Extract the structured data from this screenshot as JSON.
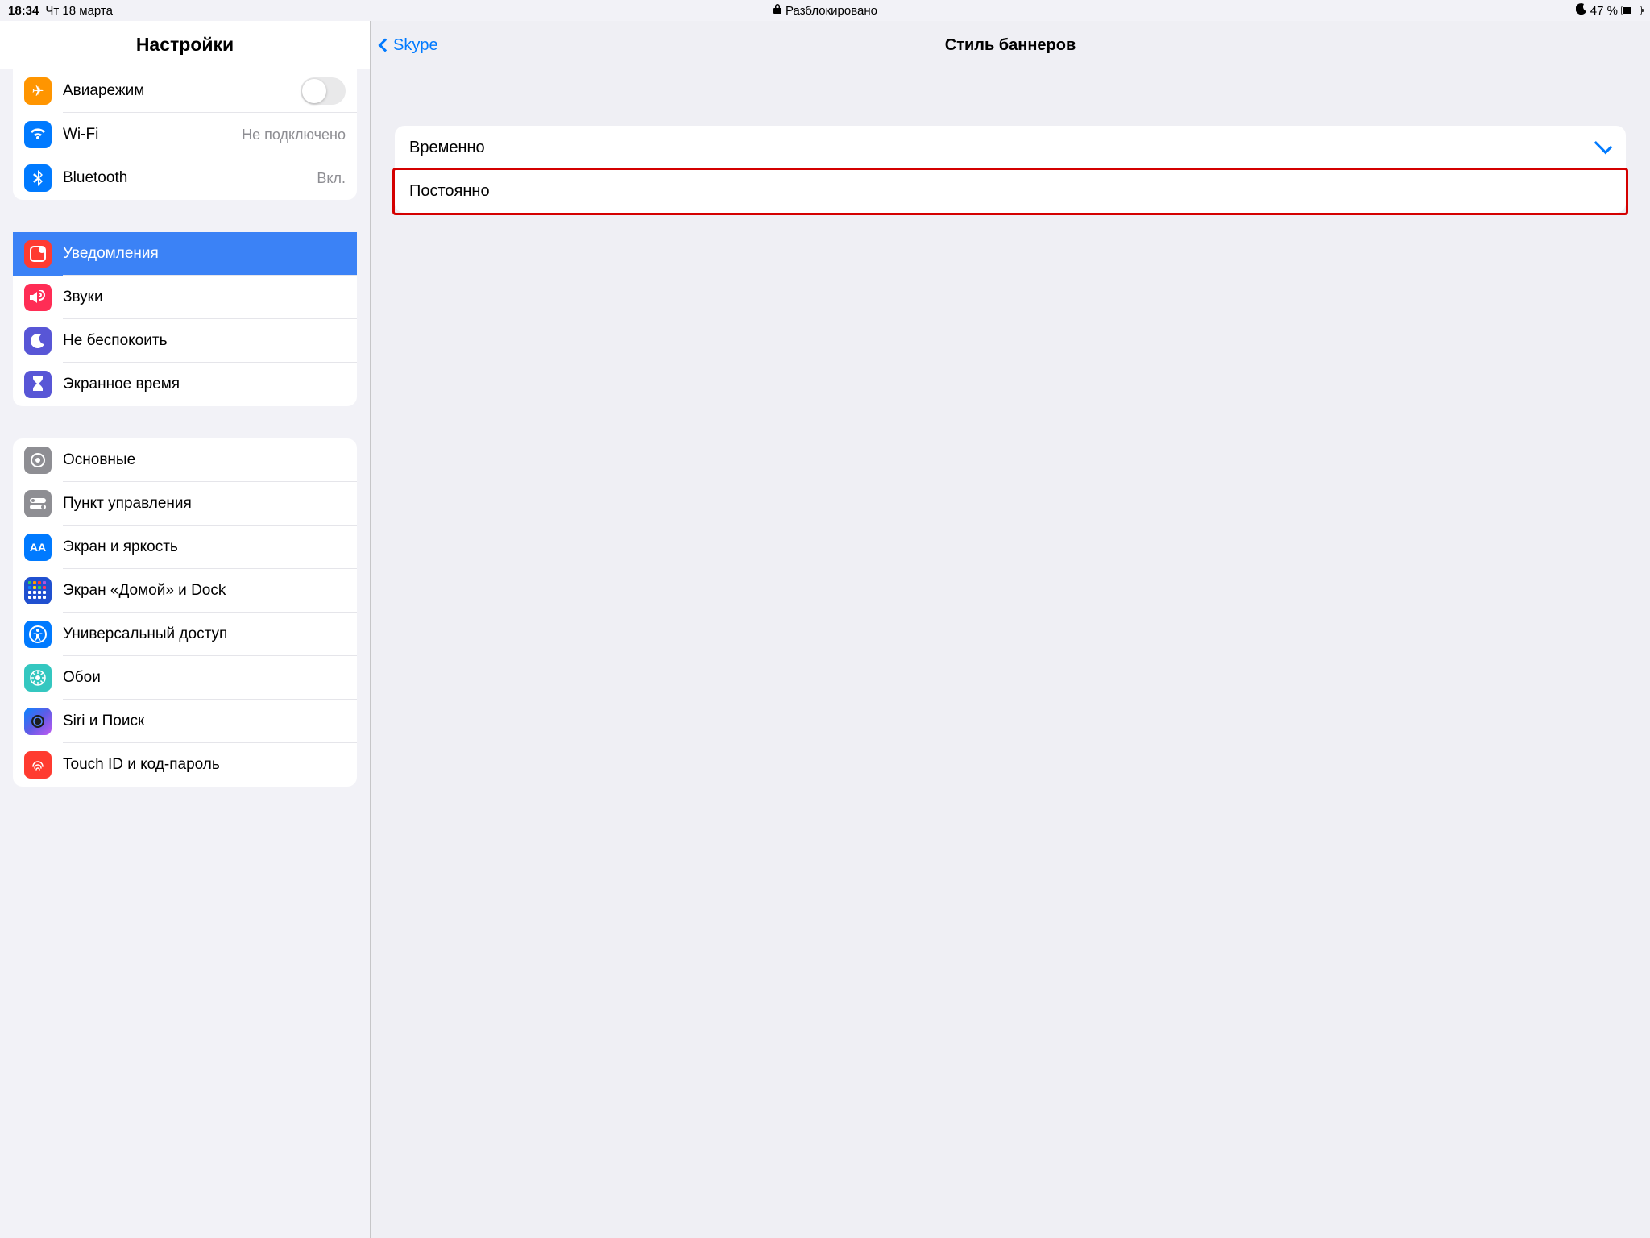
{
  "statusbar": {
    "time": "18:34",
    "date": "Чт 18 марта",
    "center_label": "Разблокировано",
    "battery": "47 %"
  },
  "left": {
    "title": "Настройки",
    "group1": [
      {
        "id": "airplane",
        "label": "Авиарежим",
        "detail": "",
        "toggle": true
      },
      {
        "id": "wifi",
        "label": "Wi-Fi",
        "detail": "Не подключено"
      },
      {
        "id": "bluetooth",
        "label": "Bluetooth",
        "detail": "Вкл."
      }
    ],
    "group2": [
      {
        "id": "notifications",
        "label": "Уведомления",
        "selected": true
      },
      {
        "id": "sounds",
        "label": "Звуки"
      },
      {
        "id": "dnd",
        "label": "Не беспокоить"
      },
      {
        "id": "screentime",
        "label": "Экранное время"
      }
    ],
    "group3": [
      {
        "id": "general",
        "label": "Основные"
      },
      {
        "id": "controlcenter",
        "label": "Пункт управления"
      },
      {
        "id": "display",
        "label": "Экран и яркость"
      },
      {
        "id": "home",
        "label": "Экран «Домой» и Dock"
      },
      {
        "id": "accessibility",
        "label": "Универсальный доступ"
      },
      {
        "id": "wallpaper",
        "label": "Обои"
      },
      {
        "id": "siri",
        "label": "Siri и Поиск"
      },
      {
        "id": "touchid",
        "label": "Touch ID и код-пароль"
      }
    ]
  },
  "right": {
    "back_label": "Skype",
    "title": "Стиль баннеров",
    "options": [
      {
        "id": "temporary",
        "label": "Временно",
        "checked": true,
        "highlight": false
      },
      {
        "id": "persistent",
        "label": "Постоянно",
        "checked": false,
        "highlight": true
      }
    ]
  }
}
